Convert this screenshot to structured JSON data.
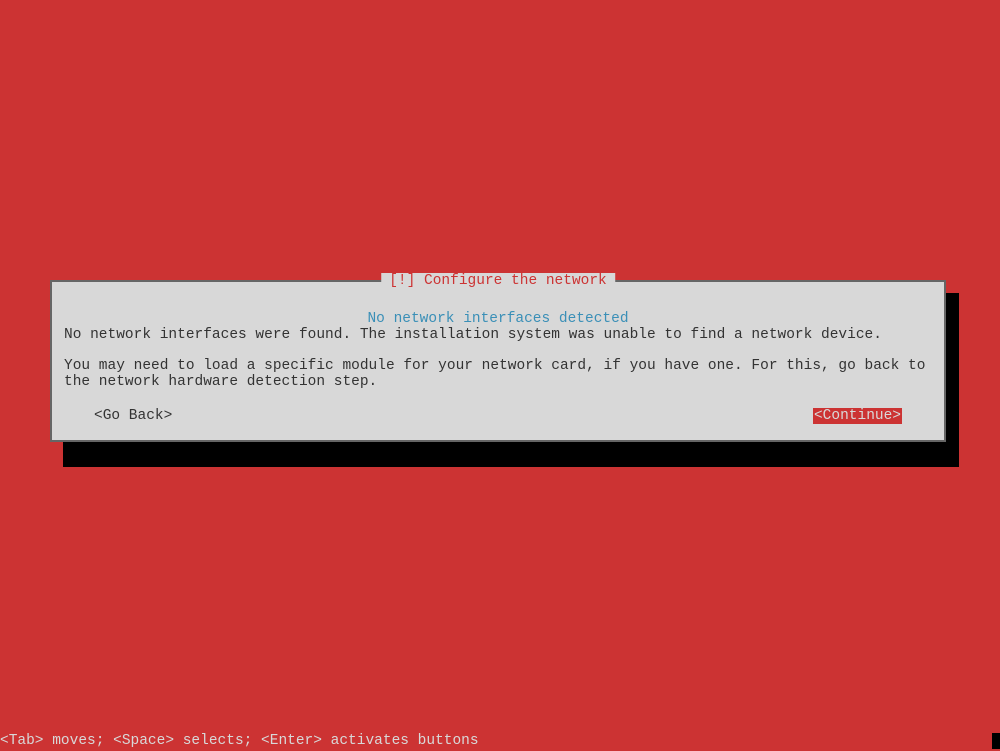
{
  "dialog": {
    "title": "[!] Configure the network",
    "subtitle": "No network interfaces detected",
    "message1": "No network interfaces were found. The installation system was unable to find a network device.",
    "message2": "You may need to load a specific module for your network card, if you have one. For this, go back to the network hardware detection step.",
    "go_back_label": "<Go Back>",
    "continue_label": "<Continue>"
  },
  "status_bar": {
    "text": "<Tab> moves; <Space> selects; <Enter> activates buttons"
  }
}
